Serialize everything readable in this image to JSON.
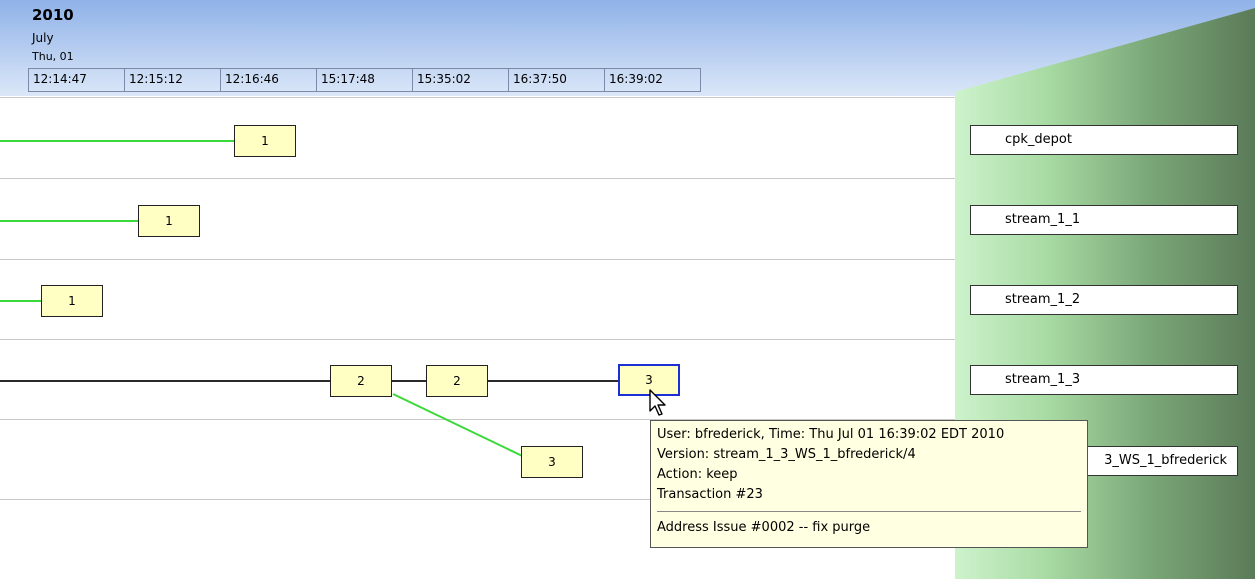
{
  "header": {
    "year": "2010",
    "month": "July",
    "day": "Thu, 01",
    "times": [
      "12:14:47",
      "12:15:12",
      "12:16:46",
      "15:17:48",
      "15:35:02",
      "16:37:50",
      "16:39:02"
    ]
  },
  "streams": [
    {
      "name": "cpk_depot"
    },
    {
      "name": "stream_1_1"
    },
    {
      "name": "stream_1_2"
    },
    {
      "name": "stream_1_3"
    },
    {
      "name": "3_WS_1_bfrederick"
    }
  ],
  "nodes": {
    "cpk_depot": "1",
    "stream_1_1": "1",
    "stream_1_2": "1",
    "stream_1_3_a": "2",
    "stream_1_3_b": "2",
    "stream_1_3_selected": "3",
    "workspace": "3"
  },
  "tooltip": {
    "line1": "User: bfrederick, Time: Thu Jul 01 16:39:02 EDT 2010",
    "line2": "Version: stream_1_3_WS_1_bfrederick/4",
    "line3": "Action: keep",
    "line4": "Transaction #23",
    "comment": "Address Issue #0002 -- fix purge"
  },
  "icons": {
    "cursor": "mouse-pointer-icon"
  },
  "colors": {
    "connector_green": "#39d939",
    "selected_border": "#1b2fd6",
    "node_fill": "#ffffc4",
    "tooltip_fill": "#ffffe1"
  }
}
